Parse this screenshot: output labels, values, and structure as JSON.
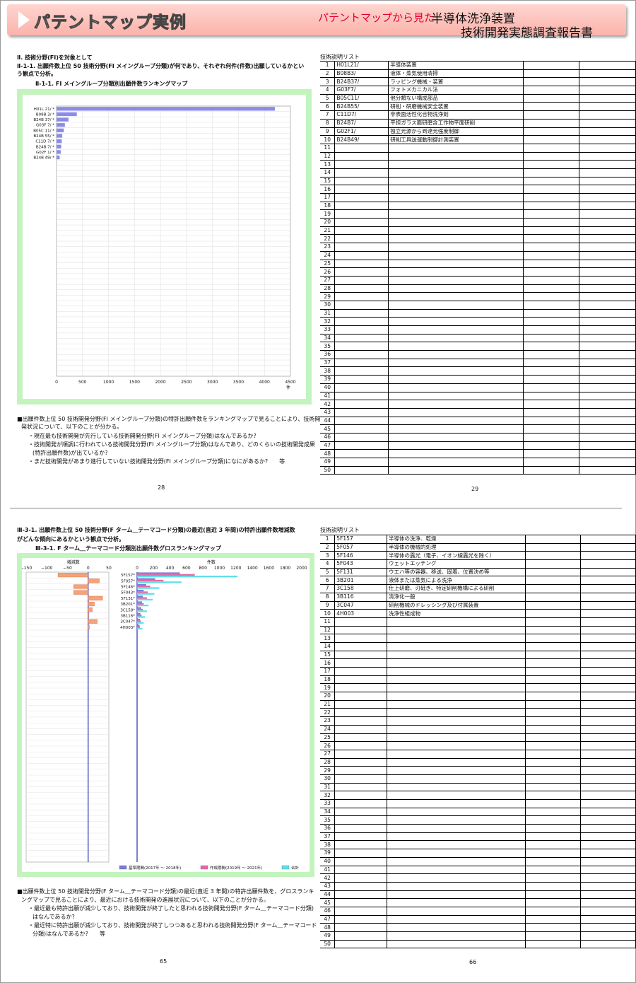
{
  "banner": {
    "title": "パテントマップ実例",
    "subtitle": "パテントマップから見た",
    "report_line1": "半導体洗浄装置",
    "report_line2": "技術開発実態調査報告書"
  },
  "top_left": {
    "section_heading": "Ⅱ. 技術分野(FI)を対象として",
    "question_line1": "Ⅱ-1-1. 出願件数上位 50 技術分野(FI メイングループ分類)が何であり、それぞれ何件(件数)出願しているかとい",
    "question_line2": "う観点で分析。",
    "chart_caption": "Ⅱ-1-1. FI メイングループ分類別出願件数ランキングマップ",
    "notes": [
      "■出願件数上位 50 技術開発分野(FI メイングループ分類)の特許出願件数をランキングマップで見ることにより、技術開",
      "発状況について、以下のことが分かる。",
      "・現在最も技術開発が先行している技術開発分野(FI メイングループ分類)はなんであるか?",
      "・技術開発が順調に行われている技術開発分野(FI メイングループ分類)はなんであり、どのくらいの技術開発成果",
      "(特許出願件数)が出ているか?",
      "・まだ技術開発があまり進行していない技術開発分野(FI メイングループ分類)になにがあるか?　　等"
    ],
    "page_number": "28"
  },
  "top_right": {
    "list_title": "技術説明リスト",
    "rows": [
      {
        "no": "1",
        "code": "H01L21/",
        "desc": "半導体装置"
      },
      {
        "no": "2",
        "code": "B08B3/",
        "desc": "液体・蒸気使用清掃"
      },
      {
        "no": "3",
        "code": "B24B37/",
        "desc": "ラッピング機械・装置"
      },
      {
        "no": "4",
        "code": "G03F7/",
        "desc": "フォトメカニカル法"
      },
      {
        "no": "5",
        "code": "B05C11/",
        "desc": "他分類ない構成部品"
      },
      {
        "no": "6",
        "code": "B24B55/",
        "desc": "研削・研磨機械安全装置"
      },
      {
        "no": "7",
        "code": "C11D7/",
        "desc": "非表面活性化合物洗浄剤"
      },
      {
        "no": "8",
        "code": "B24B7/",
        "desc": "平担ガラス面研磨含工作物平面研削"
      },
      {
        "no": "9",
        "code": "G02F1/",
        "desc": "独立光源から到達光強度制御"
      },
      {
        "no": "10",
        "code": "B24B49/",
        "desc": "研削工具送運動制御計測装置"
      }
    ],
    "empty_from": 11,
    "total_rows": 50,
    "page_number": "29"
  },
  "bottom_left": {
    "question_line1": "Ⅲ-3-1. 出願件数上位 50 技術分野(F ターム＿テーマコード分類)の最近(直近 3 年間)の特許出願件数増減数",
    "question_line2": "がどんな傾向にあるかという観点で分析。",
    "chart_caption": "Ⅲ-3-1. F ターム＿テーマコード分類別出願件数グロスランキングマップ",
    "notes": [
      "■出願件数上位 50 技術開発分野(F ターム＿テーマコード分類)の最近(直近 3 年間)の特許出願件数を、グロスランキ",
      "ングマップで見ることにより、最近における技術開発の進展状況について、以下のことが分かる。",
      "・最近最も特許出願が減少しており、技術開発が終了したと思われる技術開発分野(F ターム＿テーマコード分類)",
      "はなんであるか?",
      "・最近特に特許出願が減少しており、技術開発が終了しつつあると思われる技術開発分野(F ターム＿テーマコード",
      "分類)はなんであるか?　　等"
    ],
    "page_number": "65"
  },
  "bottom_right": {
    "list_title": "技術説明リスト",
    "rows": [
      {
        "no": "1",
        "code": "5F157",
        "desc": "半導体の洗浄、乾燥"
      },
      {
        "no": "2",
        "code": "5F057",
        "desc": "半導体の機械的処理"
      },
      {
        "no": "3",
        "code": "5F146",
        "desc": "半導体の露光（電子、イオン線露光を除く）"
      },
      {
        "no": "4",
        "code": "5F043",
        "desc": "ウェットエッチング"
      },
      {
        "no": "5",
        "code": "5F131",
        "desc": "ウエハ等の容器、移送、固着、位置決め等"
      },
      {
        "no": "6",
        "code": "3B201",
        "desc": "液体または蒸気による洗浄"
      },
      {
        "no": "7",
        "code": "3C158",
        "desc": "仕上研磨、刃砥ぎ、特定研削機構による研削"
      },
      {
        "no": "8",
        "code": "3B116",
        "desc": "清浄化一般"
      },
      {
        "no": "9",
        "code": "3C047",
        "desc": "研削機械のドレッシング及び付属装置"
      },
      {
        "no": "10",
        "code": "4H003",
        "desc": "洗浄性組成物"
      }
    ],
    "empty_from": 11,
    "total_rows": 50,
    "page_number": "66"
  },
  "chart_data": [
    {
      "type": "bar",
      "orientation": "horizontal",
      "categories": [
        "H01L 21/",
        "B08B 3/",
        "B24B 37/",
        "G03F 7/",
        "B05C 11/",
        "B24B 55/",
        "C11D 7/",
        "B24B 7/",
        "G02F 1/",
        "B24B 49/"
      ],
      "values": [
        4200,
        390,
        230,
        160,
        140,
        110,
        100,
        90,
        80,
        60
      ],
      "total_rows": 50,
      "xlim": [
        0,
        4500
      ],
      "xticks": [
        "0",
        "500",
        "1000",
        "1500",
        "2000",
        "2500",
        "3000",
        "3500",
        "4000",
        "4500"
      ],
      "xunit": "件",
      "grid": true,
      "bar_color": "#8c8ce8"
    },
    {
      "type": "bar",
      "orientation": "horizontal",
      "title_left": "増減数",
      "title_right": "件数",
      "categories": [
        "5F157",
        "5F057",
        "5F146",
        "5F043",
        "5F131",
        "3B201",
        "3C158",
        "3B116",
        "3C047",
        "4H003"
      ],
      "change_values": [
        -73,
        27,
        -35,
        -35,
        35,
        15,
        10,
        2,
        22,
        3
      ],
      "series": [
        {
          "name": "基準期間(2017年 ～ 2018年)",
          "values": [
            520,
            220,
            110,
            80,
            70,
            60,
            50,
            40,
            35,
            30
          ],
          "color": "#7b7bd8"
        },
        {
          "name": "作成期間(2019年 ～ 2021年)",
          "values": [
            700,
            320,
            160,
            130,
            120,
            80,
            70,
            55,
            45,
            35
          ],
          "color": "#e46aa6"
        },
        {
          "name": "合計",
          "values": [
            1220,
            540,
            270,
            210,
            190,
            140,
            120,
            95,
            80,
            65
          ],
          "color": "#5fe0e8"
        }
      ],
      "left_xlim": [
        -150,
        50
      ],
      "left_xticks": [
        "−150",
        "−100",
        "−50",
        "0",
        "50"
      ],
      "right_xlim": [
        0,
        2000
      ],
      "right_xticks": [
        "0",
        "200",
        "400",
        "600",
        "800",
        "1000",
        "1200",
        "1400",
        "1600",
        "1800",
        "2000"
      ],
      "total_rows": 50
    }
  ]
}
